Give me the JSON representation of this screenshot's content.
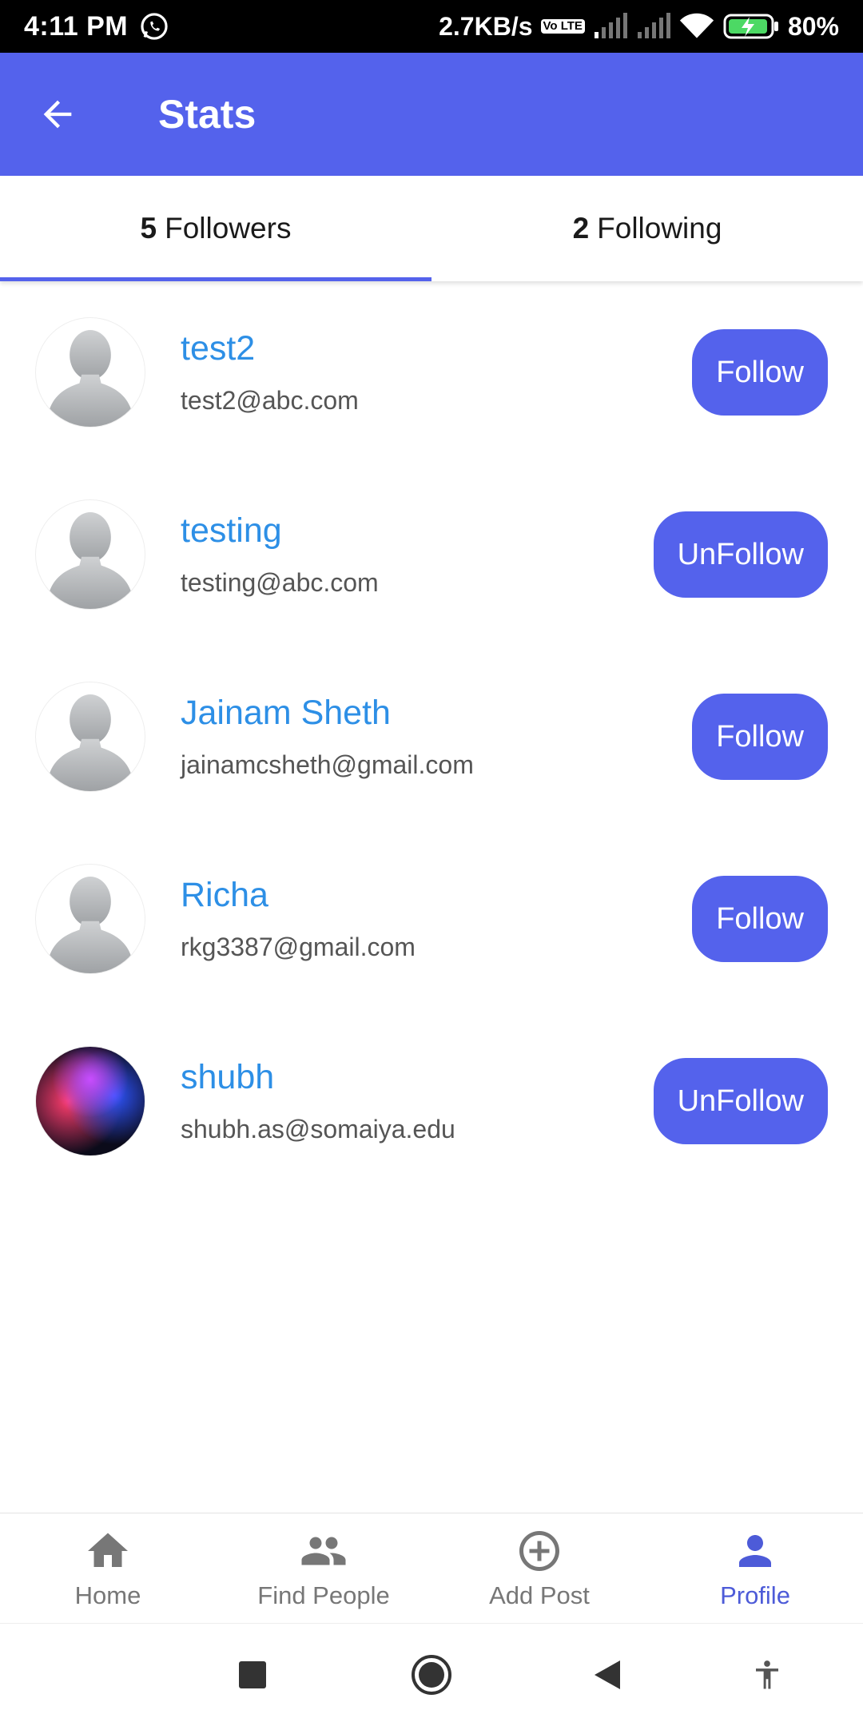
{
  "status_bar": {
    "time": "4:11 PM",
    "net_speed": "2.7KB/s",
    "volte": "Vo LTE",
    "battery": "80%"
  },
  "app_bar": {
    "title": "Stats"
  },
  "tabs": [
    {
      "count": "5",
      "label": "Followers",
      "active": true
    },
    {
      "count": "2",
      "label": "Following",
      "active": false
    }
  ],
  "users": [
    {
      "name": "test2",
      "email": "test2@abc.com",
      "action": "Follow"
    },
    {
      "name": "testing",
      "email": "testing@abc.com",
      "action": "UnFollow"
    },
    {
      "name": "Jainam Sheth",
      "email": "jainamcsheth@gmail.com",
      "action": "Follow"
    },
    {
      "name": "Richa",
      "email": "rkg3387@gmail.com",
      "action": "Follow"
    },
    {
      "name": "shubh",
      "email": "shubh.as@somaiya.edu",
      "action": "UnFollow"
    }
  ],
  "bottom_nav": [
    {
      "label": "Home",
      "icon": "home-icon"
    },
    {
      "label": "Find People",
      "icon": "people-icon"
    },
    {
      "label": "Add Post",
      "icon": "add-circle-icon"
    },
    {
      "label": "Profile",
      "icon": "person-icon"
    }
  ],
  "colors": {
    "primary": "#5462ec",
    "name_text": "#2d8fe6",
    "active_nav": "#4d5bd8"
  }
}
